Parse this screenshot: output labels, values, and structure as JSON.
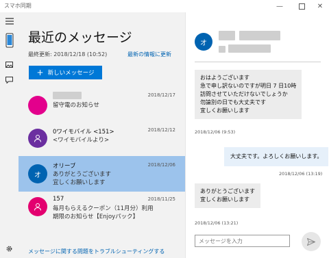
{
  "window": {
    "title": "スマホ同期",
    "minimize_icon": "minimize-icon",
    "maximize_icon": "maximize-icon",
    "close_icon": "close-icon"
  },
  "rail": {
    "items": [
      "hamburger-menu-icon",
      "phone-icon",
      "photos-icon",
      "messages-icon",
      "settings-icon"
    ]
  },
  "list": {
    "heading": "最近のメッセージ",
    "last_updated": "最終更新: 2018/12/18 (10:52)",
    "refresh_link": "最新の情報に更新",
    "new_message_label": "新しいメッセージ",
    "conversations": [
      {
        "name": "",
        "preview": "留守電のお知らせ",
        "date": "2018/12/17",
        "avatar_text": "",
        "avatar_color": "#e3008c"
      },
      {
        "name": "0ワイモバイル <151>",
        "preview": "<ワイモバイルより>",
        "date": "2018/12/12",
        "avatar_text": "",
        "avatar_color": "#6b2fa0"
      },
      {
        "name": "オリーブ",
        "preview": "ありがとうございます\n宜しくお願いします",
        "date": "2018/12/06",
        "avatar_text": "オ",
        "avatar_color": "#0063b1"
      },
      {
        "name": "157",
        "preview": "毎月もらえるクーポン（11月分）利用\n期限のお知らせ【Enjoyパック】",
        "date": "2018/11/25",
        "avatar_text": "",
        "avatar_color": "#e3006f"
      }
    ],
    "trouble_link": "メッセージに関する問題をトラブルシューティングする"
  },
  "chat": {
    "contact_initial": "オ",
    "contact_avatar_color": "#0063b1",
    "messages": [
      {
        "direction": "in",
        "text": "おはようございます\n急で申し訳ないのですが明日 7 日10時\n訪問させていただけないでしょうか\n勿論別の日でも大丈夫です\n宜しくお願いします",
        "time": "2018/12/06 (9:53)"
      },
      {
        "direction": "out",
        "text": "大丈夫です。よろしくお願いします。",
        "time": "2018/12/06 (13:19)"
      },
      {
        "direction": "in",
        "text": "ありがとうございます\n宜しくお願いします",
        "time": "2018/12/06 (13:21)"
      }
    ],
    "input_placeholder": "メッセージを入力",
    "send_icon": "send-icon"
  },
  "colors": {
    "accent": "#0078d7",
    "selected": "#9cc3ec",
    "link": "#0063b1"
  }
}
